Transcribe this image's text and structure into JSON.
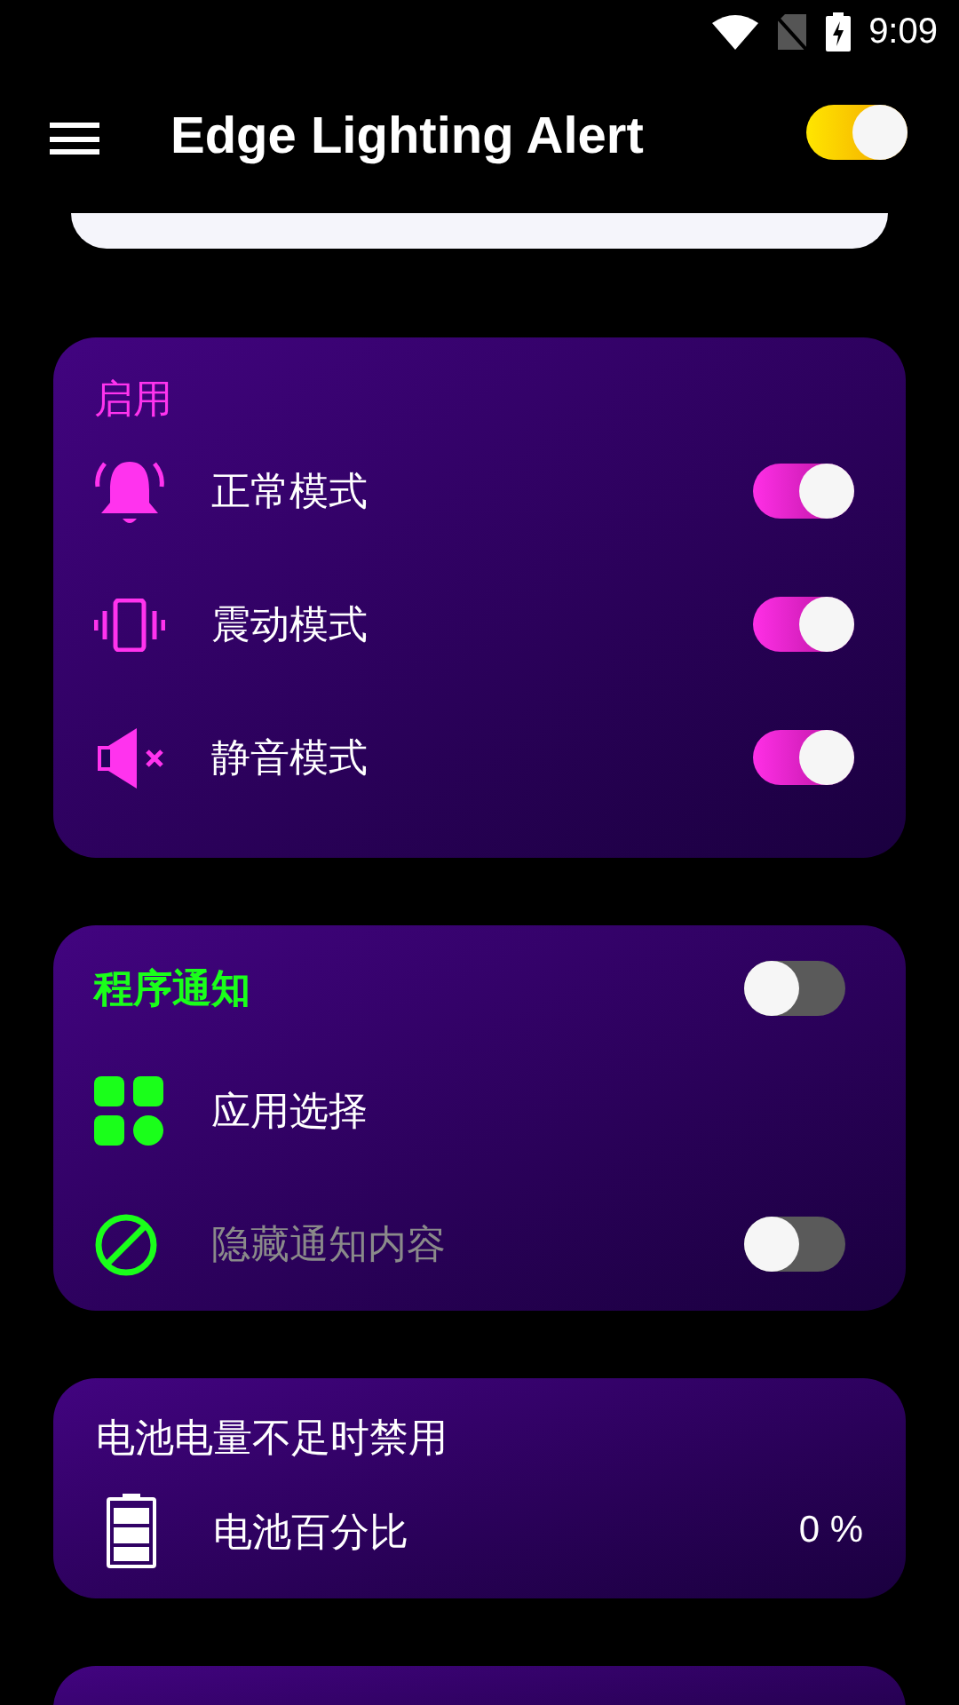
{
  "status_bar": {
    "time": "9:09"
  },
  "app_bar": {
    "title": "Edge Lighting Alert",
    "master_switch": {
      "on": true
    }
  },
  "sections": [
    {
      "kind": "modes",
      "title": "启用",
      "rows": [
        {
          "kind": "toggle",
          "label": "正常模式",
          "on": true
        },
        {
          "kind": "toggle",
          "label": "震动模式",
          "on": true
        },
        {
          "kind": "toggle",
          "label": "静音模式",
          "on": true
        }
      ]
    },
    {
      "kind": "notifications",
      "title": "程序通知",
      "on": false,
      "rows": [
        {
          "kind": "link",
          "label": "应用选择"
        },
        {
          "kind": "toggle",
          "label": "隐藏通知内容",
          "on": false,
          "disabled": true
        }
      ]
    },
    {
      "kind": "battery",
      "title": "电池电量不足时禁用",
      "rows": [
        {
          "kind": "reading",
          "label": "电池百分比",
          "value": "0 %"
        }
      ]
    },
    {
      "kind": "partial"
    }
  ]
}
